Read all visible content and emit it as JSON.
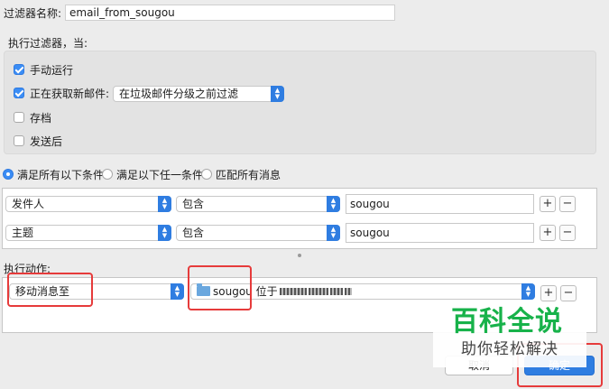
{
  "filter_name": {
    "label": "过滤器名称:",
    "value": "email_from_sougou"
  },
  "execute_heading": "执行过滤器，当:",
  "triggers": [
    {
      "label": "手动运行",
      "checked": true
    },
    {
      "label": "正在获取新邮件:",
      "checked": true,
      "select_value": "在垃圾邮件分级之前过滤"
    },
    {
      "label": "存档",
      "checked": false
    },
    {
      "label": "发送后",
      "checked": false
    }
  ],
  "match_options": [
    {
      "label": "满足所有以下条件",
      "selected": true
    },
    {
      "label": "满足以下任一条件",
      "selected": false
    },
    {
      "label": "匹配所有消息",
      "selected": false
    }
  ],
  "criteria": [
    {
      "field": "发件人",
      "operator": "包含",
      "value": "sougou",
      "add_label": "+",
      "remove_label": "−"
    },
    {
      "field": "主题",
      "operator": "包含",
      "value": "sougou",
      "add_label": "+",
      "remove_label": "−"
    }
  ],
  "actions_heading": "执行动作:",
  "action": {
    "type": "移动消息至",
    "folder": "sougou",
    "location_prefix": "位于",
    "add_label": "+",
    "remove_label": "−"
  },
  "buttons": {
    "cancel": "取消",
    "ok": "确定"
  },
  "watermark": {
    "title": "百科全说",
    "subtitle": "助你轻松解决"
  },
  "colors": {
    "accent": "#2e7de1",
    "highlight_box": "#e63b3b",
    "watermark_green": "#17b24a"
  }
}
